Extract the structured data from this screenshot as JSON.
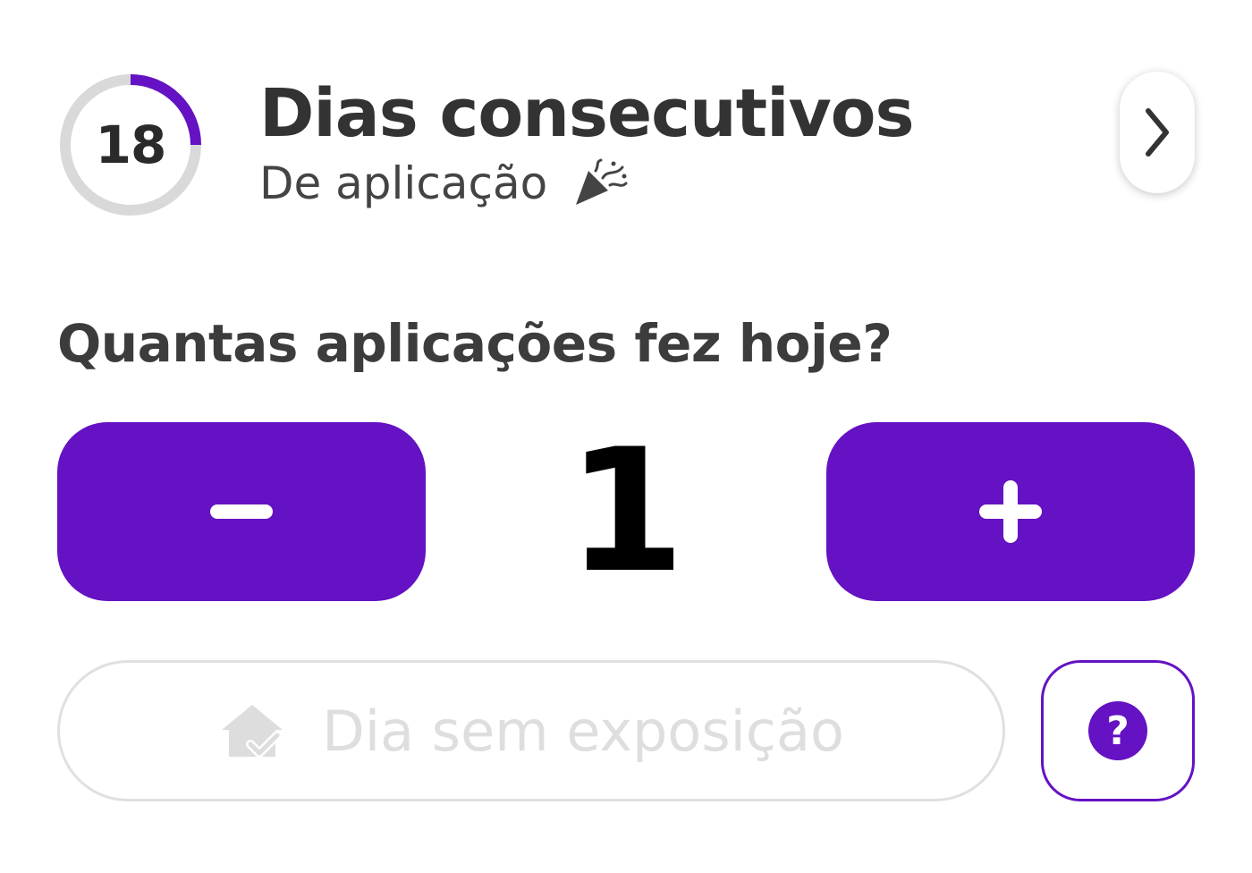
{
  "streak": {
    "count": "18",
    "progress": 0.25,
    "title": "Dias consecutivos",
    "subtitle": "De aplicação",
    "subtitle_icon": "party-popper-icon",
    "next_icon": "chevron-right-icon"
  },
  "question": "Quantas aplicações fez hoje?",
  "counter": {
    "value": "1",
    "decrement_icon": "minus-icon",
    "increment_icon": "plus-icon"
  },
  "no_exposure": {
    "label": "Dia sem exposição",
    "icon": "house-check-icon"
  },
  "help": {
    "icon_text": "?",
    "icon": "question-circle-icon"
  },
  "colors": {
    "accent": "#6412c3",
    "ring_track": "#d9d9d9",
    "disabled_text": "#dedede",
    "disabled_border": "#e0e0e0"
  }
}
